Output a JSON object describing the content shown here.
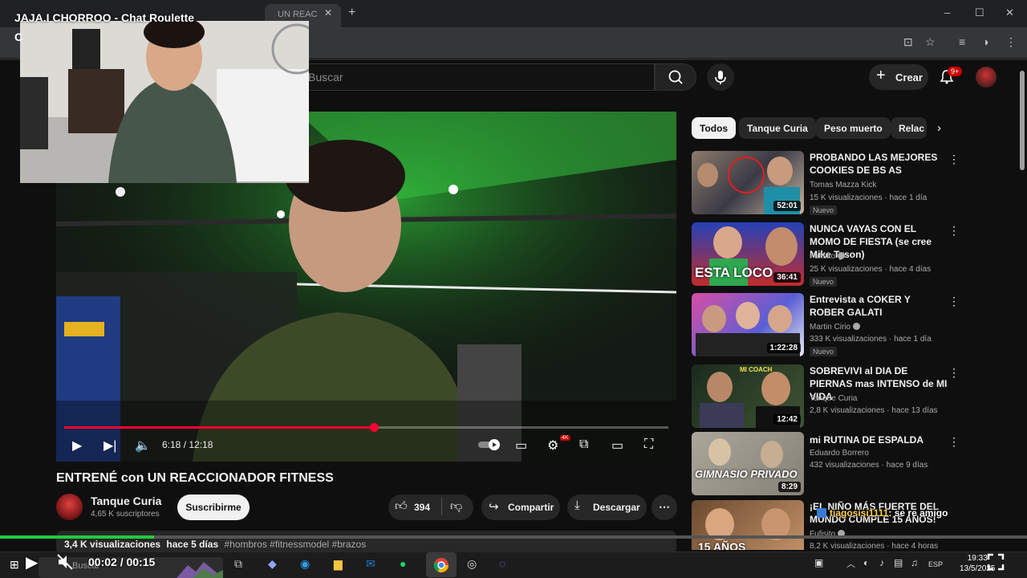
{
  "browser": {
    "tab_title": "UN REAC",
    "controls": {
      "minimize": "–",
      "maximize": "☐",
      "close": "✕"
    }
  },
  "overlay": {
    "title": "JAJA.I CHORROO - Chat Roulette",
    "title_line2": "C"
  },
  "youtube": {
    "search_placeholder": "Buscar",
    "create_label": "Crear",
    "notifications_badge": "9+"
  },
  "player": {
    "current_time": "6:18",
    "duration": "12:18",
    "time_display": "6:18 / 12:18",
    "progress": 0.512,
    "settings_badge": "4K"
  },
  "video": {
    "title": "ENTRENÉ con UN REACCIONADOR FITNESS",
    "channel": "Tanque Curia",
    "subscribers": "4,65 K suscriptores",
    "subscribe_label": "Suscribirme",
    "likes": "394",
    "share_label": "Compartir",
    "download_label": "Descargar",
    "views": "3,4 K visualizaciones",
    "age": "hace 5 días",
    "hashtags": "#hombros #fitnessmodel #brazos"
  },
  "chips": [
    "Todos",
    "Tanque Curia",
    "Peso muerto",
    "Relac"
  ],
  "recommendations": [
    {
      "title": "PROBANDO LAS MEJORES COOKIES DE BS AS",
      "channel": "Tomas Mazza Kick",
      "views": "15 K visualizaciones",
      "age": "hace 1 día",
      "duration": "52:01",
      "badge": "Nuevo",
      "verified": false
    },
    {
      "title": "NUNCA VAYAS CON EL MOMO DE FIESTA (se cree Mike Tyson)",
      "channel": "Fufisito",
      "views": "25 K visualizaciones",
      "age": "hace 4 días",
      "duration": "36:41",
      "badge": "Nuevo",
      "verified": true,
      "thumb_text": "ESTA LOCO"
    },
    {
      "title": "Entrevista a COKER Y ROBER GALATI",
      "channel": "Martin Cirio",
      "views": "333 K visualizaciones",
      "age": "hace 1 día",
      "duration": "1:22:28",
      "badge": "Nuevo",
      "verified": true
    },
    {
      "title": "SOBREVIVI al DIA DE PIERNAS mas INTENSO de MI VIDA",
      "channel": "Tanque Curia",
      "views": "2,8 K visualizaciones",
      "age": "hace 13 días",
      "duration": "12:42",
      "badge": "",
      "verified": false,
      "thumb_text": "MI COACH"
    },
    {
      "title": "mi RUTINA DE ESPALDA",
      "channel": "Eduardo Borrero",
      "views": "432 visualizaciones",
      "age": "hace 9 días",
      "duration": "8:29",
      "badge": "",
      "verified": false,
      "thumb_text": "GIMNASIO PRIVADO"
    },
    {
      "title": "¡EL NIÑO MÁS FUERTE DEL MUNDO CUMPLE 15 AÑOS!",
      "channel": "Fufisito",
      "views": "8,2 K visualizaciones",
      "age": "hace 4 horas",
      "duration": "",
      "badge": "",
      "verified": true,
      "thumb_text": "15 AÑOS"
    }
  ],
  "chat": {
    "user": "tiagosisi1111",
    "message": ": se re amigo"
  },
  "recording": {
    "time": "00:02 / 00:15",
    "progress": 0.15
  },
  "taskbar": {
    "search_placeholder": "Buscar",
    "language": "ESP",
    "time": "19:33",
    "date": "13/5/2025"
  },
  "colors": {
    "accent_red": "#ff0033",
    "rec_green": "#1ecb3c",
    "chat_user": "#ffd24d"
  }
}
